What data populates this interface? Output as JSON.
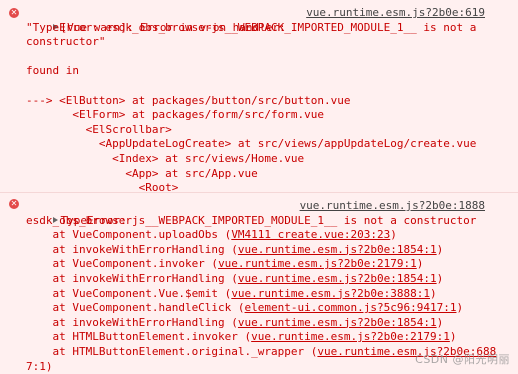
{
  "entry1": {
    "icon": "error-circle-icon",
    "header": "[Vue warn]: Error in v-on handler:",
    "source": "vue.runtime.esm.js?2b0e:619",
    "msg_line1": "\"TypeError: esdk_obs_browserjs__WEBPACK_IMPORTED_MODULE_1__ is not a",
    "msg_line2": "constructor\"",
    "found_in": "found in",
    "trace": [
      "---> <ElButton> at packages/button/src/button.vue",
      "       <ElForm> at packages/form/src/form.vue",
      "         <ElScrollbar>",
      "           <AppUpdateLogCreate> at src/views/appUpdateLog/create.vue",
      "             <Index> at src/views/Home.vue",
      "               <App> at src/App.vue",
      "                 <Root>"
    ]
  },
  "entry2": {
    "icon": "error-circle-icon",
    "header": "TypeError:",
    "source": "vue.runtime.esm.js?2b0e:1888",
    "msg_line1": "esdk_obs_browserjs__WEBPACK_IMPORTED_MODULE_1__ is not a constructor",
    "stack": [
      {
        "fn": "    at VueComponent.uploadObs (",
        "loc": "VM4111 create.vue:203:23",
        "end": ")"
      },
      {
        "fn": "    at invokeWithErrorHandling (",
        "loc": "vue.runtime.esm.js?2b0e:1854:1",
        "end": ")"
      },
      {
        "fn": "    at VueComponent.invoker (",
        "loc": "vue.runtime.esm.js?2b0e:2179:1",
        "end": ")"
      },
      {
        "fn": "    at invokeWithErrorHandling (",
        "loc": "vue.runtime.esm.js?2b0e:1854:1",
        "end": ")"
      },
      {
        "fn": "    at VueComponent.Vue.$emit (",
        "loc": "vue.runtime.esm.js?2b0e:3888:1",
        "end": ")"
      },
      {
        "fn": "    at VueComponent.handleClick (",
        "loc": "element-ui.common.js?5c96:9417:1",
        "end": ")"
      },
      {
        "fn": "    at invokeWithErrorHandling (",
        "loc": "vue.runtime.esm.js?2b0e:1854:1",
        "end": ")"
      },
      {
        "fn": "    at HTMLButtonElement.invoker (",
        "loc": "vue.runtime.esm.js?2b0e:2179:1",
        "end": ")"
      },
      {
        "fn": "    at HTMLButtonElement.original._wrapper (",
        "loc": "vue.runtime.esm.js?2b0e:688",
        "end": ""
      }
    ],
    "last_line": "7:1)"
  },
  "watermark": "CSDN @阳光明丽"
}
